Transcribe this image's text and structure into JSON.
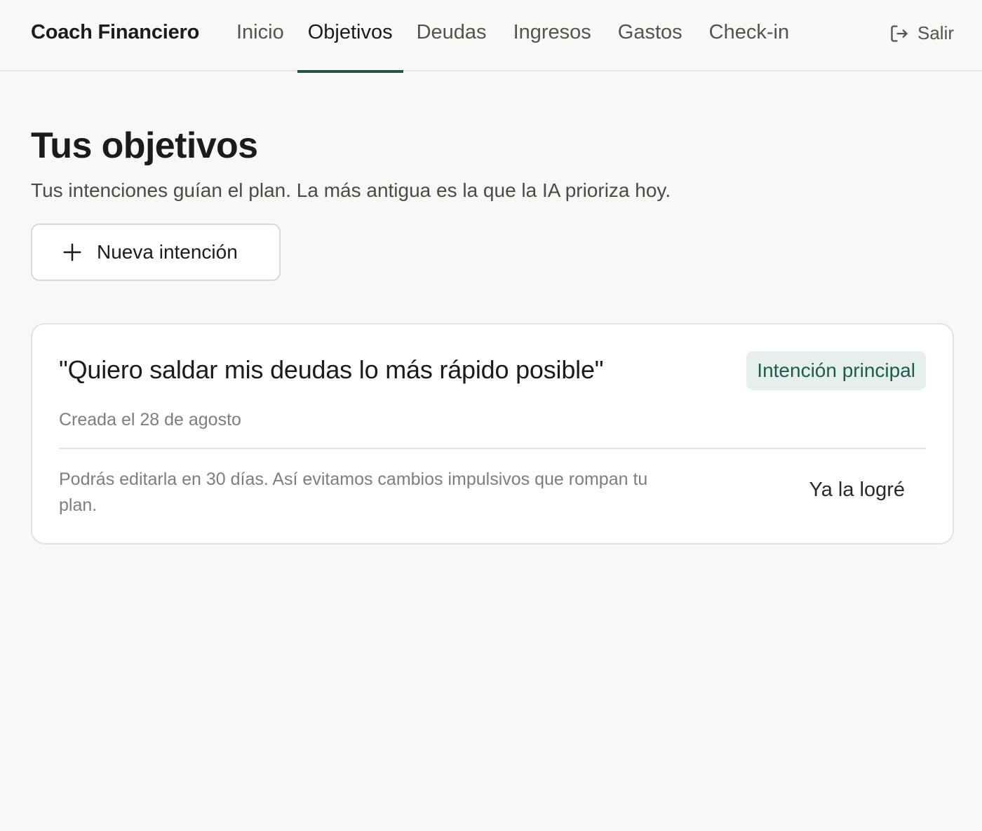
{
  "header": {
    "brand": "Coach Financiero",
    "nav": [
      {
        "label": "Inicio"
      },
      {
        "label": "Objetivos",
        "active": true
      },
      {
        "label": "Deudas"
      },
      {
        "label": "Ingresos"
      },
      {
        "label": "Gastos"
      },
      {
        "label": "Check-in"
      }
    ],
    "logout_label": "Salir",
    "logout_icon": "logout-icon"
  },
  "main": {
    "title": "Tus objetivos",
    "subtitle": "Tus intenciones guían el plan. La más antigua es la que la IA prioriza hoy.",
    "new_button_label": "Nueva intención",
    "new_button_icon": "plus-icon",
    "goal_card": {
      "quote": "\"Quiero saldar mis deudas lo más rápido posible\"",
      "badge": "Intención principal",
      "created": "Creada el 28 de agosto",
      "note": "Podrás editarla en 30 días. Así evitamos cambios impulsivos que rompan tu plan.",
      "achieved_label": "Ya la logré"
    }
  },
  "colors": {
    "background": "#f9f8f6",
    "accent": "#24524a",
    "badge_bg": "#e5f0ed",
    "badge_text": "#1f5a4f"
  }
}
